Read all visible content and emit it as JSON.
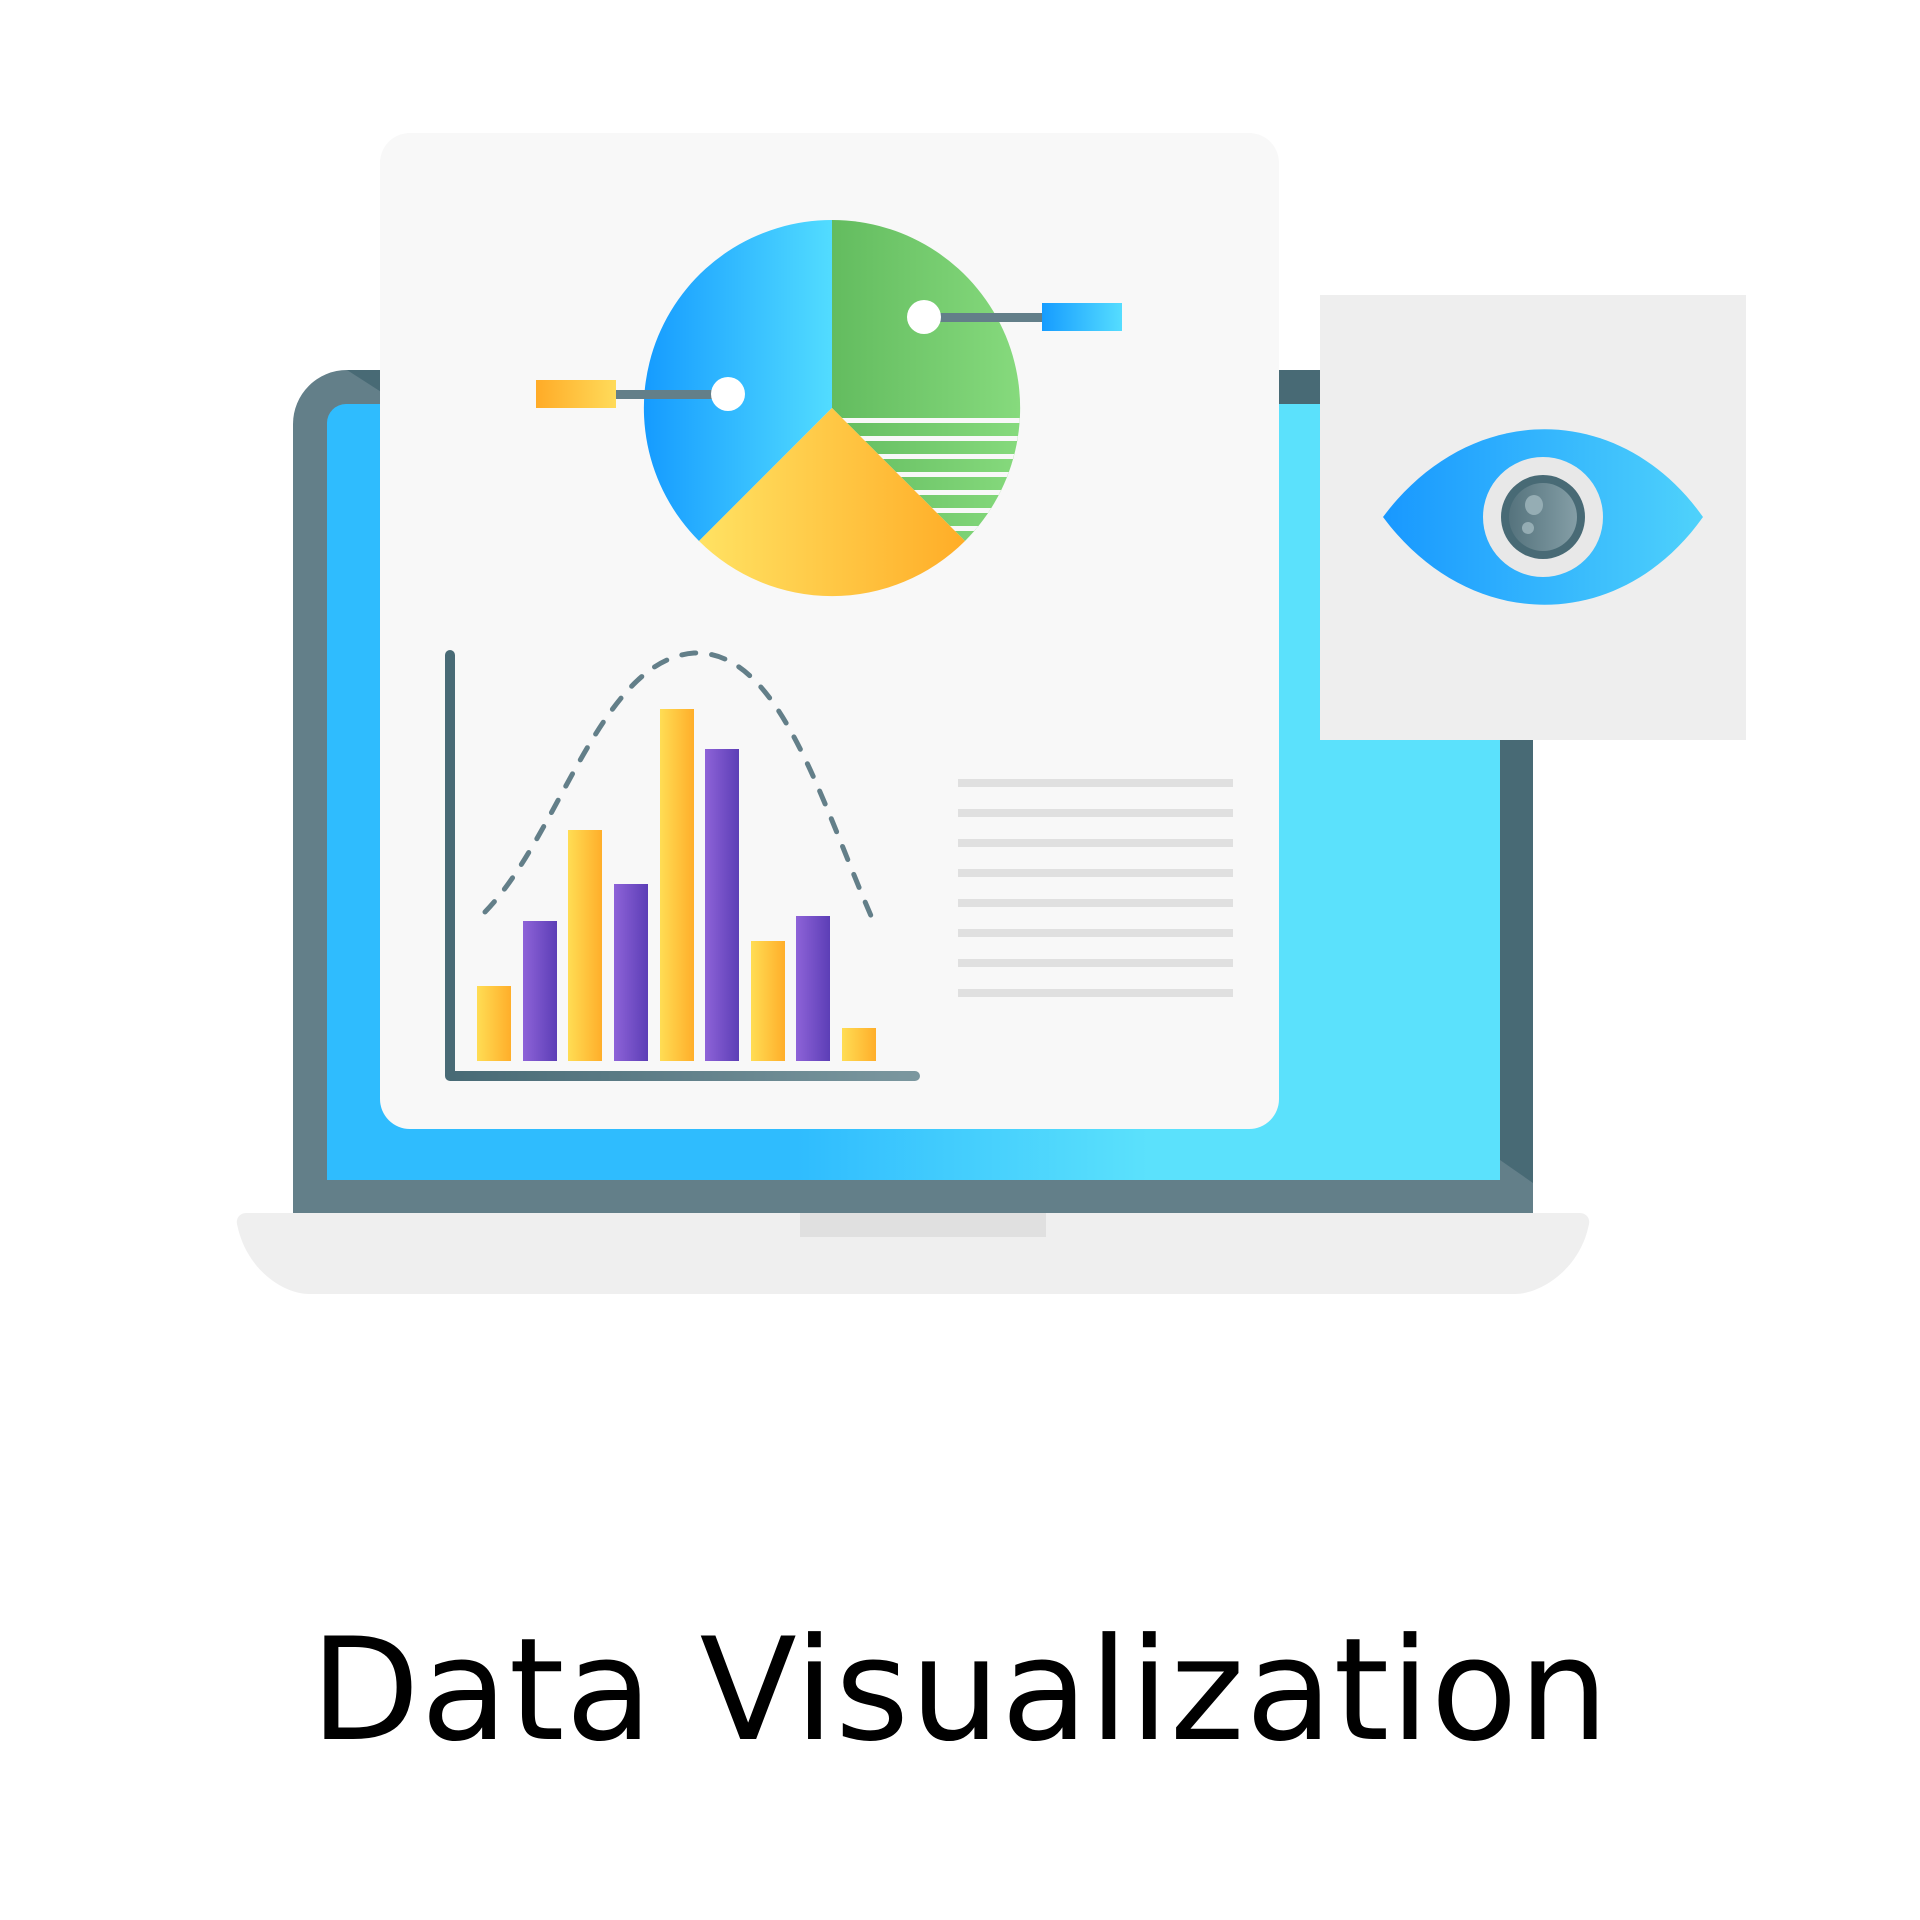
{
  "caption": "Data Visualization",
  "icons": [
    "laptop-icon",
    "report-document-icon",
    "pie-chart-icon",
    "bar-chart-icon",
    "trend-curve-icon",
    "eye-icon"
  ],
  "colors": {
    "laptop_frame": "#637f89",
    "laptop_frame_dark": "#486a75",
    "screen_start": "#2fbcfe",
    "screen_end": "#5be1fc",
    "paper": "#f8f8f8",
    "laptop_base": "#efefef",
    "pie_blue_start": "#159bff",
    "pie_blue_end": "#52dcff",
    "pie_green_start": "#63bc5f",
    "pie_green_end": "#86da7d",
    "pie_orange_start": "#ffe263",
    "pie_orange_end": "#ffad27",
    "bar_orange_start": "#ffdd54",
    "bar_orange_end": "#ffae2a",
    "bar_purple_start": "#8e63d8",
    "bar_purple_end": "#5c3eb6",
    "axis": "#496b77",
    "eye_panel": "#eeeeee",
    "eye_blue_start": "#1898ff",
    "eye_blue_end": "#4fd2fb",
    "text_lines": "#e0e0e0"
  }
}
